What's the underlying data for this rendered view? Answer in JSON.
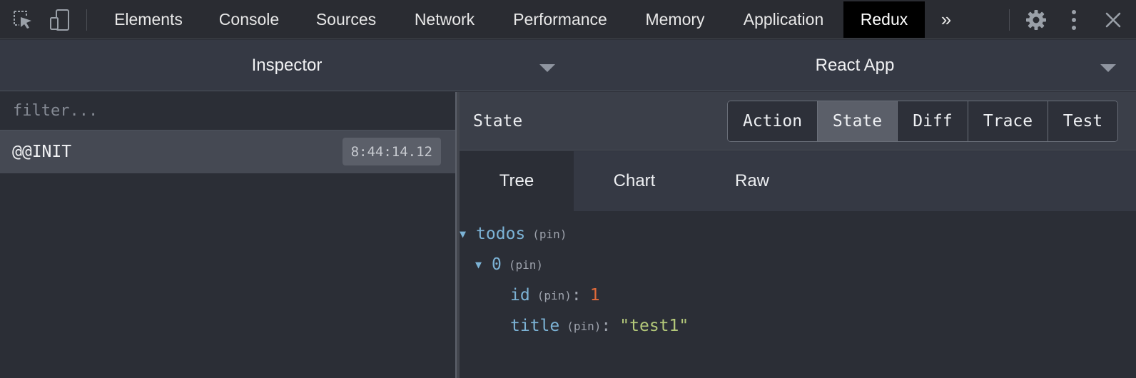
{
  "toolbar": {
    "icons": [
      "inspect-element-icon",
      "device-toggle-icon"
    ],
    "tabs": [
      "Elements",
      "Console",
      "Sources",
      "Network",
      "Performance",
      "Memory",
      "Application",
      "Redux"
    ],
    "active_tab": "Redux",
    "overflow": "»",
    "right_icons": [
      "gear-icon",
      "kebab-menu-icon",
      "close-icon"
    ]
  },
  "subbar": {
    "monitor": "Inspector",
    "instance": "React App"
  },
  "left": {
    "filter_placeholder": "filter...",
    "actions": [
      {
        "name": "@@INIT",
        "time": "8:44:14.12"
      }
    ]
  },
  "right": {
    "header_label": "State",
    "segments": [
      "Action",
      "State",
      "Diff",
      "Trace",
      "Test"
    ],
    "active_segment": "State",
    "view_tabs": [
      "Tree",
      "Chart",
      "Raw"
    ],
    "active_view_tab": "Tree",
    "tree": {
      "root_key": "todos",
      "item_key": "0",
      "pin": "(pin)",
      "colon": ":",
      "fields": [
        {
          "key": "id",
          "value": "1"
        },
        {
          "key": "title",
          "value": "\"test1\""
        }
      ]
    }
  },
  "colors": {
    "background": "#2b2e36",
    "toolbar": "#2a2c32",
    "active_tab": "#000000",
    "key": "#7cb3d6",
    "number": "#e06a3a",
    "string": "#b4c97a"
  }
}
